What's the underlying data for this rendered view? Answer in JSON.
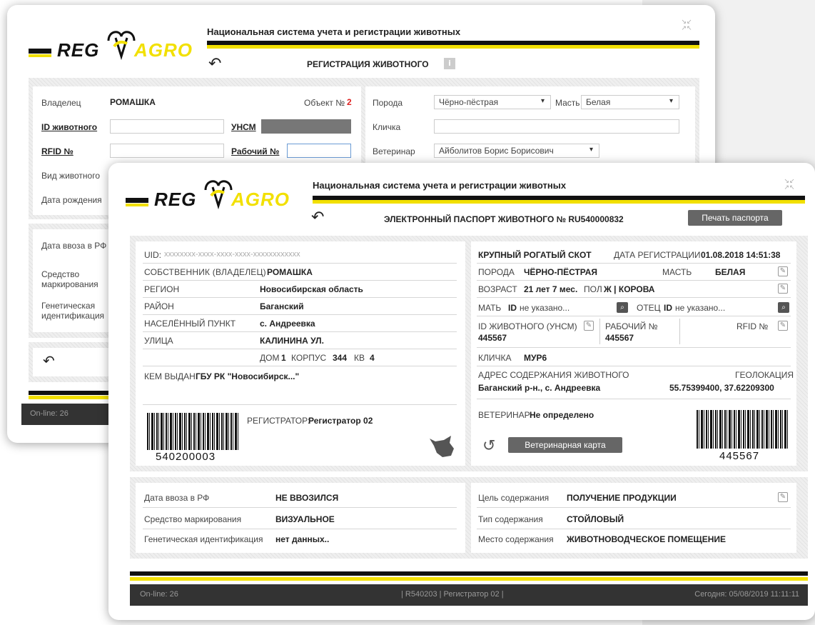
{
  "brand": {
    "reg": "REG",
    "agro": "AGRO",
    "system_title": "Национальная система учета и регистрации животных",
    "compress_glyph": "⇲"
  },
  "back": {
    "page_title": "РЕГИСТРАЦИЯ ЖИВОТНОГО",
    "left": {
      "owner_label": "Владелец",
      "owner_value": "РОМАШКА",
      "object_label": "Объект №",
      "object_number": "2",
      "id_label": "ID животного",
      "unsm_label": "УНСМ",
      "rfid_label": "RFID №",
      "work_label": "Рабочий №",
      "kind_label": "Вид животного",
      "birth_label": "Дата рождения"
    },
    "right": {
      "breed_label": "Порода",
      "breed_value": "Чёрно-пёстрая",
      "color_label": "Масть",
      "color_value": "Белая",
      "nick_label": "Кличка",
      "vet_label": "Ветеринар",
      "vet_value": "Айболитов Борис Борисович"
    },
    "lower": {
      "import_label": "Дата ввоза в РФ",
      "marking_label": "Средство маркирования",
      "genetic_label": "Генетическая идентификация"
    },
    "footer_online": "On-line: 26"
  },
  "front": {
    "passport_title": "ЭЛЕКТРОННЫЙ ПАСПОРТ ЖИВОТНОГО № RU540000832",
    "print_button": "Печать паспорта",
    "owner_panel": {
      "uid_label": "UID:",
      "uid_value": "xxxxxxxx-xxxx-xxxx-xxxx-xxxxxxxxxxxx",
      "owner_label": "СОБСТВЕННИК (владелец)",
      "owner_value": "РОМАШКА",
      "region_label": "РЕГИОН",
      "region_value": "Новосибирская область",
      "district_label": "РАЙОН",
      "district_value": "Баганский",
      "locality_label": "НАСЕЛЁННЫЙ ПУНКТ",
      "locality_value": "с. Андреевка",
      "street_label": "УЛИЦА",
      "street_value": "КАЛИНИНА УЛ.",
      "house_label": "ДОМ",
      "house_value": "1",
      "korpus_label": "КОРПУС",
      "korpus_value": "344",
      "kv_label": "КВ",
      "kv_value": "4",
      "issued_label": "КЕМ ВЫДАН",
      "issued_value": "ГБУ РК \"Новосибирск...\"",
      "registrar_label": "РЕГИСТРАТОР:",
      "registrar_value": "Регистратор 02",
      "barcode_number": "540200003"
    },
    "animal_panel": {
      "type": "КРУПНЫЙ РОГАТЫЙ СКОТ",
      "reg_date_label": "ДАТА РЕГИСТРАЦИИ",
      "reg_date_value": "01.08.2018 14:51:38",
      "breed_label": "ПОРОДА",
      "breed_value": "ЧЁРНО-ПЁСТРАЯ",
      "color_label": "МАСТЬ",
      "color_value": "БЕЛАЯ",
      "age_label": "ВОЗРАСТ",
      "age_value": "21 лет 7 мес.",
      "sex_label": "ПОЛ",
      "sex_value": "Ж | КОРОВА",
      "mother_label": "МАТЬ",
      "mother_id_label": "ID",
      "mother_id_value": "не указано...",
      "father_label": "ОТЕЦ",
      "father_id_label": "ID",
      "father_id_value": "не указано...",
      "animal_id_label": "ID ЖИВОТНОГО (УНСМ)",
      "animal_id_value": "445567",
      "work_label": "РАБОЧИЙ №",
      "work_value": "445567",
      "rfid_label": "RFID №",
      "nick_label": "КЛИЧКА",
      "nick_value": "МУР6",
      "address_label": "АДРЕС СОДЕРЖАНИЯ ЖИВОТНОГО",
      "address_value": "Баганский р-н., с. Андреевка",
      "geo_label": "ГЕОЛОКАЦИЯ",
      "geo_value": "55.75399400, 37.62209300",
      "vet_label": "ВЕТЕРИНАР:",
      "vet_value": "Не определено",
      "vet_card_button": "Ветеринарная карта",
      "barcode_number": "445567"
    },
    "lower_left": {
      "import_label": "Дата ввоза в РФ",
      "import_value": "НЕ ВВОЗИЛСЯ",
      "marking_label": "Средство маркирования",
      "marking_value": "ВИЗУАЛЬНОЕ",
      "genetic_label": "Генетическая идентификация",
      "genetic_value": "нет данных.."
    },
    "lower_right": {
      "purpose_label": "Цель содержания",
      "purpose_value": "ПОЛУЧЕНИЕ ПРОДУКЦИИ",
      "type_label": "Тип содержания",
      "type_value": "СТОЙЛОВЫЙ",
      "place_label": "Место содержания",
      "place_value": "ЖИВОТНОВОДЧЕСКОЕ ПОМЕЩЕНИЕ"
    },
    "footer": {
      "online": "On-line: 26",
      "center": "| R540203 | Регистратор 02 |",
      "today": "Сегодня: 05/08/2019 11:11:11"
    }
  }
}
